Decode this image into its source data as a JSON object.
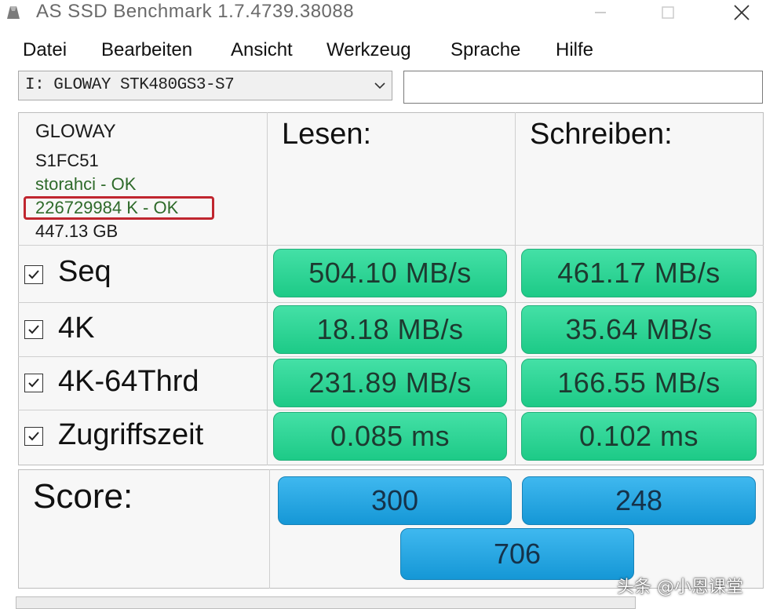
{
  "window": {
    "title": "AS SSD Benchmark 1.7.4739.38088"
  },
  "menu": [
    "Datei",
    "Bearbeiten",
    "Ansicht",
    "Werkzeug",
    "Sprache",
    "Hilfe"
  ],
  "drive": {
    "selected": "I: GLOWAY STK480GS3-S7",
    "search_value": ""
  },
  "info": {
    "vendor": "GLOWAY",
    "firmware": "S1FC51",
    "driver_status": "storahci - OK",
    "alignment_status": "226729984 K - OK",
    "capacity": "447.13 GB"
  },
  "columns": {
    "read": "Lesen:",
    "write": "Schreiben:"
  },
  "rows": [
    {
      "label": "Seq",
      "checked": true,
      "read": "504.10 MB/s",
      "write": "461.17 MB/s"
    },
    {
      "label": "4K",
      "checked": true,
      "read": "18.18 MB/s",
      "write": "35.64 MB/s"
    },
    {
      "label": "4K-64Thrd",
      "checked": true,
      "read": "231.89 MB/s",
      "write": "166.55 MB/s"
    },
    {
      "label": "Zugriffszeit",
      "checked": true,
      "read": "0.085 ms",
      "write": "0.102 ms"
    }
  ],
  "score": {
    "label": "Score:",
    "read": "300",
    "write": "248",
    "total": "706"
  },
  "watermark": "头条 @小恩课堂",
  "colors": {
    "result_green": "#2fd696",
    "score_blue": "#29a9e4",
    "highlight_red": "#c0262f"
  }
}
